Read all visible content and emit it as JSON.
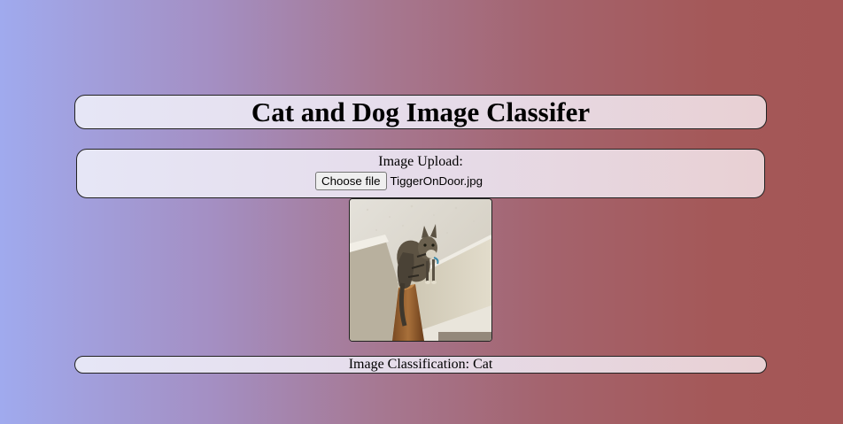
{
  "header": {
    "title": "Cat and Dog Image Classifer"
  },
  "upload": {
    "label": "Image Upload:",
    "button_label": "Choose file",
    "file_name": "TiggerOnDoor.jpg"
  },
  "result": {
    "text": "Image Classification: Cat"
  },
  "colors": {
    "background_left": "#a0aaee",
    "background_right": "#a45656",
    "panel_fill": "#e6e6f6",
    "panel_border": "#222222"
  }
}
